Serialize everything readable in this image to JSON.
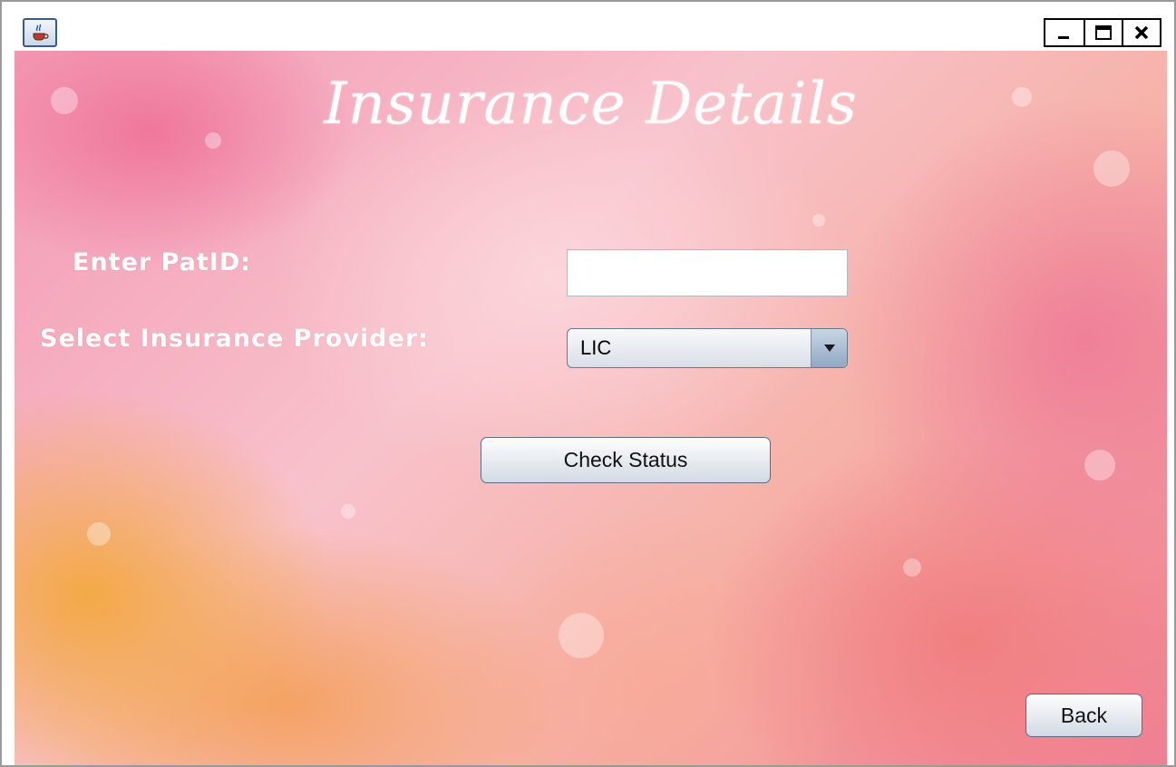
{
  "window": {
    "app_icon": "java-coffee-icon",
    "controls": {
      "minimize_icon": "minimize-icon",
      "maximize_icon": "maximize-icon",
      "close_icon": "close-icon"
    }
  },
  "form": {
    "title": "Insurance Details",
    "patid_label": "Enter PatID:",
    "patid_value": "",
    "provider_label": "Select Insurance Provider:",
    "provider_selected": "LIC",
    "check_status_label": "Check Status",
    "back_label": "Back"
  },
  "colors": {
    "text_light": "#ffffff",
    "button_border": "#5d6d80",
    "dropdown_arrow": "#8fa8c4"
  }
}
